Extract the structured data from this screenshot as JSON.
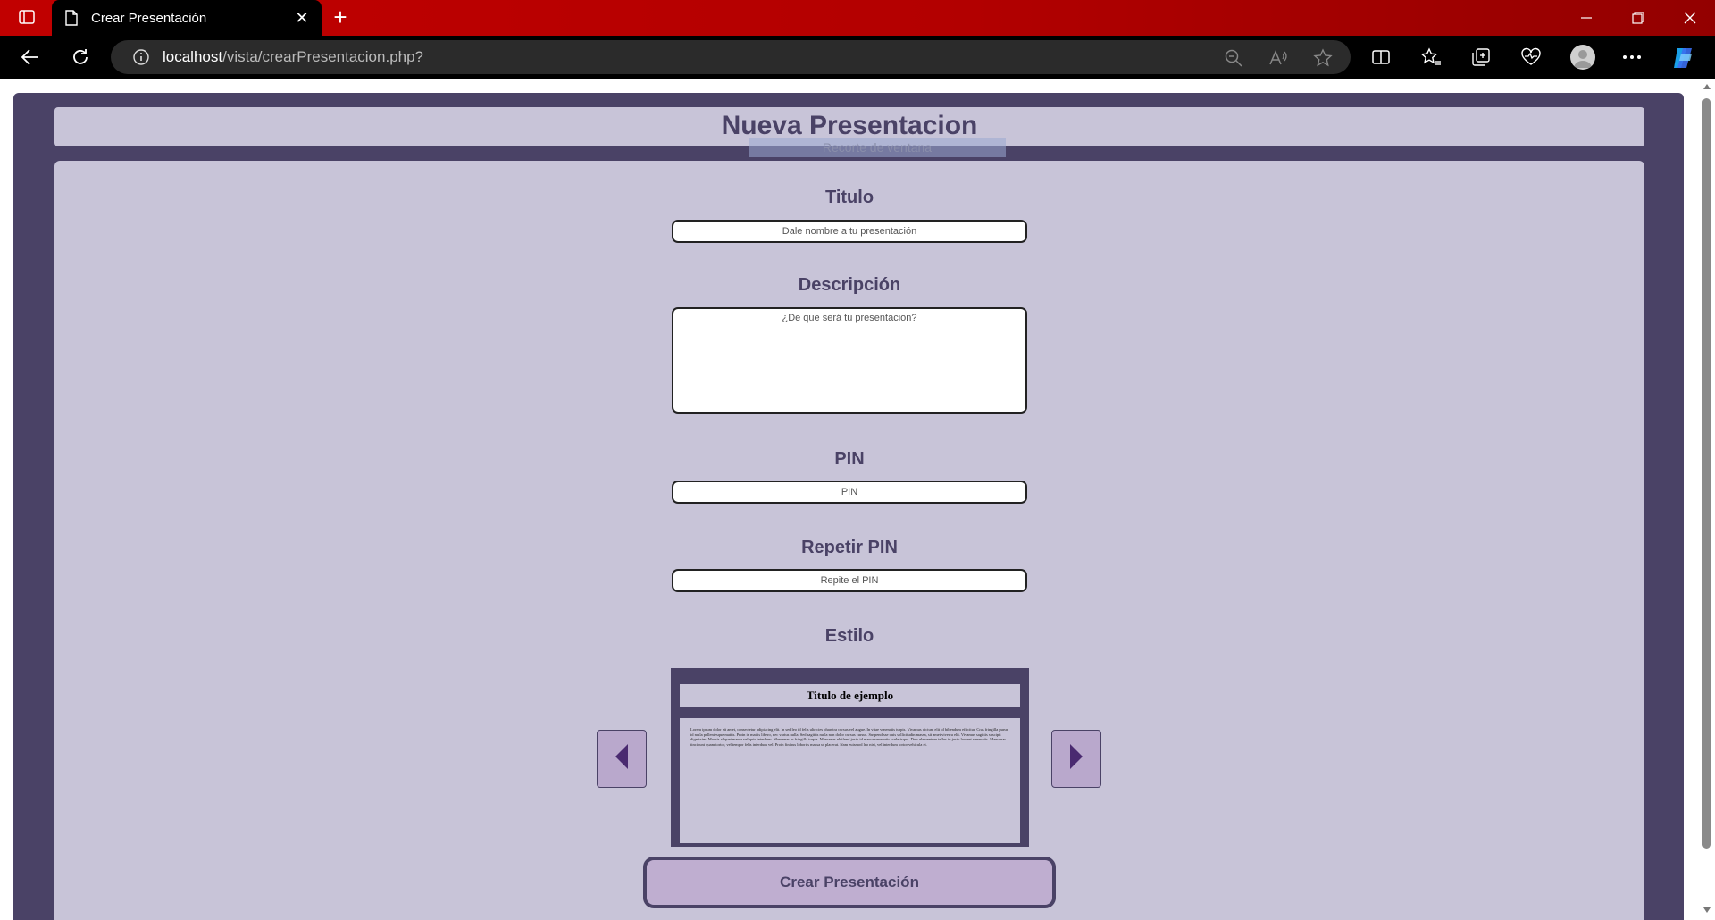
{
  "browser": {
    "tab_title": "Crear Presentación",
    "url_host": "localhost",
    "url_path": "/vista/crearPresentacion.php?"
  },
  "page": {
    "heading": "Nueva Presentacion",
    "overlay_text": "Recorte de ventana",
    "fields": {
      "titulo_label": "Titulo",
      "titulo_placeholder": "Dale nombre a tu presentación",
      "descripcion_label": "Descripción",
      "descripcion_placeholder": "¿De que será tu presentacion?",
      "pin_label": "PIN",
      "pin_placeholder": "PIN",
      "repetir_pin_label": "Repetir PIN",
      "repetir_pin_placeholder": "Repite el PIN",
      "estilo_label": "Estilo"
    },
    "preview": {
      "title": "Titulo de ejemplo",
      "body": "Lorem ipsum dolor sit amet, consectetur adipiscing elit. In sed leo id felis ultricies pharetra cursus vel augue. In vitae venenatis turpis. Vivamus dictum elit id bibendum efficitur. Cras fringilla purus id nulla pellentesque mattis. Proin in mattis libero, nec varius nulla. Sed sagittis nulla non dolor cursus cursus. Suspendisse quis sollicitudin massa, sit amet viverra elit. Vivamus sagittis suscipit dignissim. Mauris aliquet massa vel quis interdum. Maecenas in fringilla turpis. Maecenas eleifend justo id massa venenatis scelerisque. Duis elementum tellus in justo laoreet venenatis. Maecenas tincidunt quam tortor, vel tempor felis interdum vel. Proin finibus lobortis massa ut placerat. Nam euismod leo nisi, vel interdum tortor vehicula et."
    },
    "create_button": "Crear Presentación"
  },
  "colors": {
    "titlebar": "#c10000",
    "page_bg": "#4a4266",
    "panel": "#c8c4d8",
    "button": "#bfaed0"
  },
  "icons": [
    "tab-actions-icon",
    "page-icon",
    "close-icon",
    "new-tab-icon",
    "minimize-icon",
    "restore-icon",
    "back-icon",
    "refresh-icon",
    "info-icon",
    "zoom-out-icon",
    "read-aloud-icon",
    "favorite-star-icon",
    "split-screen-icon",
    "favorites-icon",
    "collections-icon",
    "browser-essentials-icon",
    "profile-avatar-icon",
    "more-menu-icon",
    "copilot-icon",
    "arrow-left-icon",
    "arrow-right-icon"
  ]
}
